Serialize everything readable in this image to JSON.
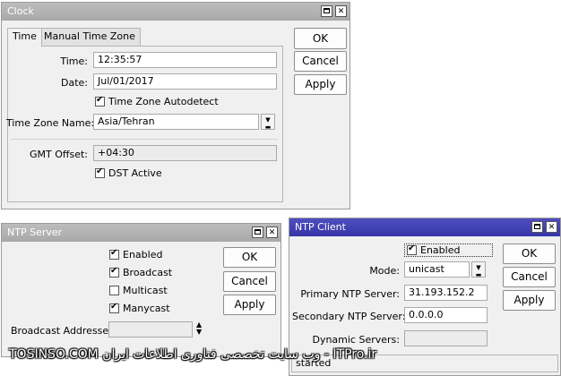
{
  "clock": {
    "title": "Clock",
    "tabs": [
      "Time",
      "Manual Time Zone"
    ],
    "time_label": "Time:",
    "time_value": "12:35:57",
    "date_label": "Date:",
    "date_value": "Jul/01/2017",
    "tz_autodetect_label": "Time Zone Autodetect",
    "tz_name_label": "Time Zone Name:",
    "tz_name_value": "Asia/Tehran",
    "gmt_offset_label": "GMT Offset:",
    "gmt_offset_value": "+04:30",
    "dst_label": "DST Active",
    "ok": "OK",
    "cancel": "Cancel",
    "apply": "Apply"
  },
  "ntp_server": {
    "title": "NTP Server",
    "enabled_label": "Enabled",
    "enabled": true,
    "broadcast_label": "Broadcast",
    "broadcast": true,
    "multicast_label": "Multicast",
    "multicast": false,
    "manycast_label": "Manycast",
    "manycast": true,
    "broadcast_addresses_label": "Broadcast Addresses:",
    "broadcast_addresses_value": "",
    "ok": "OK",
    "cancel": "Cancel",
    "apply": "Apply"
  },
  "ntp_client": {
    "title": "NTP Client",
    "enabled_label": "Enabled",
    "enabled": true,
    "mode_label": "Mode:",
    "mode_value": "unicast",
    "primary_label": "Primary NTP Server:",
    "primary_value": "31.193.152.2",
    "secondary_label": "Secondary NTP Server:",
    "secondary_value": "0.0.0.0",
    "dynamic_label": "Dynamic Servers:",
    "dynamic_value": "",
    "status": "started",
    "ok": "OK",
    "cancel": "Cancel",
    "apply": "Apply"
  },
  "watermark": "TOSINSO.COM وب سایت تخصصی فناوری اطلاعات ایران - ITPro.ir",
  "colors": {
    "active_title": "#3a3aaf",
    "inactive_title": "#b0b0b0",
    "window_bg": "#f0f0f0"
  }
}
